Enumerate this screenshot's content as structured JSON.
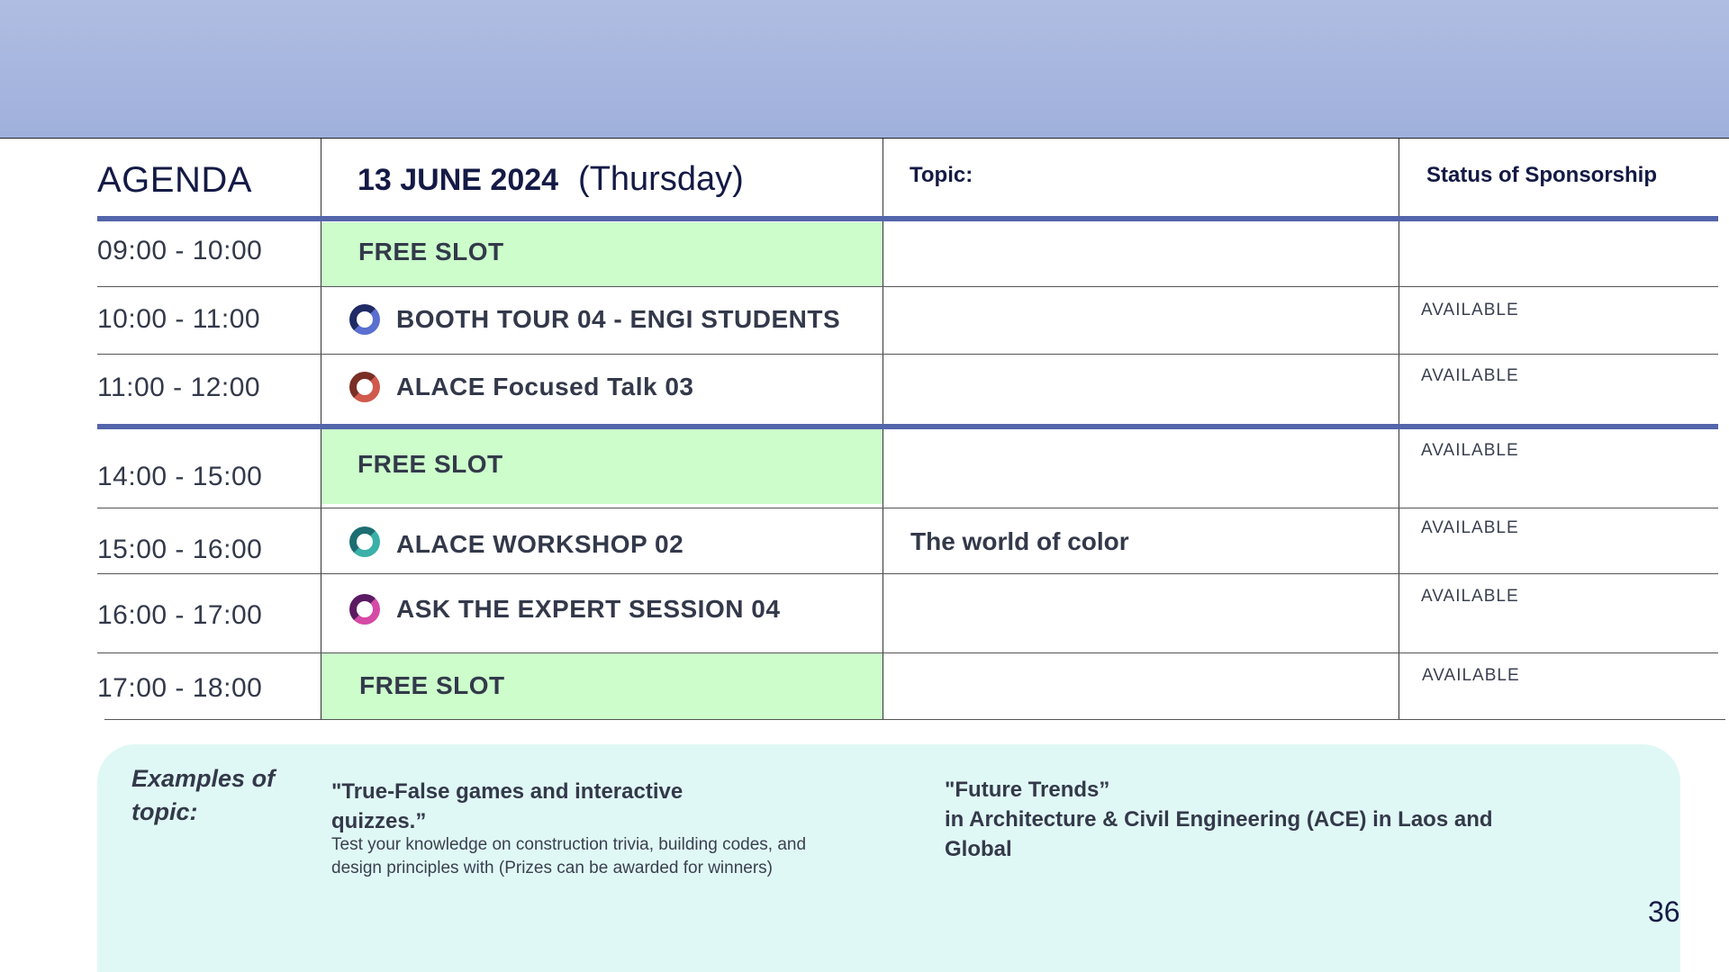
{
  "header": {
    "agenda_label": "AGENDA",
    "date": "13 JUNE 2024",
    "day": "(Thursday)",
    "topic_label": "Topic:",
    "status_label": "Status of Sponsorship"
  },
  "rows": [
    {
      "time": "09:00 - 10:00",
      "session": "FREE SLOT",
      "free": true,
      "icon": "",
      "topic": "",
      "status": ""
    },
    {
      "time": "10:00 - 11:00",
      "session": "BOOTH TOUR 04 - ENGI STUDENTS",
      "free": false,
      "icon": "blue-ring-icon",
      "topic": "",
      "status": "AVAILABLE"
    },
    {
      "time": "11:00 - 12:00",
      "session": "ALACE Focused Talk 03",
      "free": false,
      "icon": "red-ring-icon",
      "topic": "",
      "status": "AVAILABLE"
    },
    {
      "time": "14:00 - 15:00",
      "session": "FREE SLOT",
      "free": true,
      "icon": "",
      "topic": "",
      "status": "AVAILABLE"
    },
    {
      "time": "15:00 - 16:00",
      "session": "ALACE WORKSHOP 02",
      "free": false,
      "icon": "teal-ring-icon",
      "topic": "The world of color",
      "status": "AVAILABLE"
    },
    {
      "time": "16:00 - 17:00",
      "session": "ASK THE EXPERT SESSION 04",
      "free": false,
      "icon": "pink-ring-icon",
      "topic": "",
      "status": "AVAILABLE"
    },
    {
      "time": "17:00 - 18:00",
      "session": "FREE SLOT",
      "free": true,
      "icon": "",
      "topic": "",
      "status": "AVAILABLE"
    }
  ],
  "examples": {
    "label": "Examples of topic:",
    "example1_title": "\"True-False games and interactive quizzes.”",
    "example1_desc": "Test your knowledge on construction trivia, building codes, and design principles with (Prizes can be awarded for winners)",
    "example2_line1": "\"Future Trends”",
    "example2_line2": "in Architecture & Civil Engineering (ACE) in Laos and Global"
  },
  "page_number": "36",
  "colors": {
    "banner": "#a9b8e0",
    "divider": "#5365ab",
    "free_slot": "#ccfdcb",
    "examples_bg": "#e0f8f5",
    "heading": "#141a45"
  }
}
